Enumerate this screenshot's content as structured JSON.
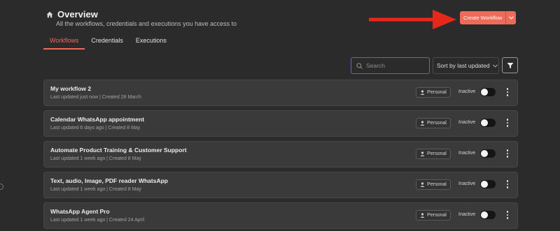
{
  "header": {
    "icon": "home-icon",
    "title": "Overview",
    "subtitle": "All the workflows, credentials and executions you have access to"
  },
  "create": {
    "label": "Create Workflow",
    "caret_icon": "chevron-down-icon",
    "color": "#ee6a59"
  },
  "annotation": {
    "icon": "red-arrow-icon",
    "color": "#e8271b"
  },
  "tabs": [
    {
      "label": "Workflows",
      "active": true
    },
    {
      "label": "Credentials",
      "active": false
    },
    {
      "label": "Executions",
      "active": false
    }
  ],
  "search": {
    "placeholder": "Search",
    "value": ""
  },
  "sort": {
    "value": "Sort by last updated"
  },
  "filter": {
    "icon": "filter-icon"
  },
  "workflows": [
    {
      "name": "My workflow 2",
      "meta": "Last updated just now | Created 28 March",
      "owner": "Personal",
      "status": "Inactive"
    },
    {
      "name": "Calendar WhatsApp appointment",
      "meta": "Last updated 6 days ago | Created 8 May",
      "owner": "Personal",
      "status": "Inactive"
    },
    {
      "name": "Automate Product Training & Customer Support",
      "meta": "Last updated 1 week ago | Created 8 May",
      "owner": "Personal",
      "status": "Inactive"
    },
    {
      "name": "Text, audio, Image, PDF reader WhatsApp",
      "meta": "Last updated 1 week ago | Created 8 May",
      "owner": "Personal",
      "status": "Inactive"
    },
    {
      "name": "WhatsApp Agent Pro",
      "meta": "Last updated 1 week ago | Created 24 April",
      "owner": "Personal",
      "status": "Inactive"
    }
  ]
}
